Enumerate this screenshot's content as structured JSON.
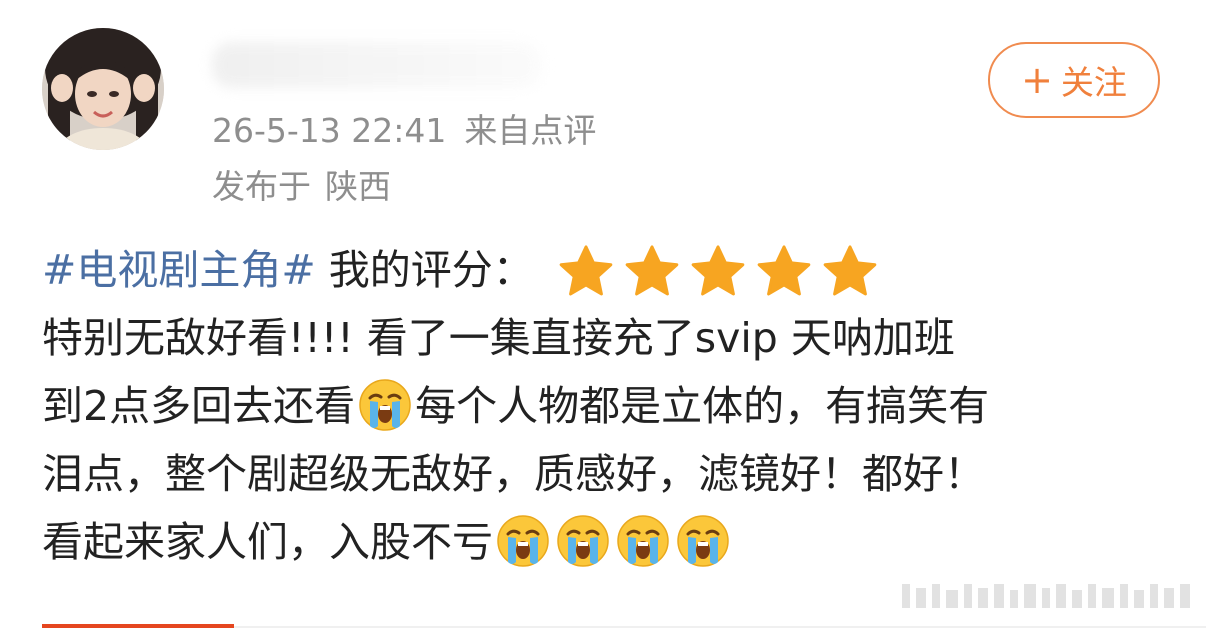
{
  "user": {
    "avatar_icon": "user-avatar-photo",
    "post_time": "26-5-13 22:41",
    "source": "来自点评",
    "location_prefix": "发布于",
    "location": "陕西"
  },
  "follow_button": {
    "icon": "plus-icon",
    "plus_symbol": "+",
    "label": "关注",
    "color": "#f0803c"
  },
  "post": {
    "hashtag": "#电视剧主角#",
    "rating_label": " 我的评分：",
    "rating_stars": 5,
    "rating_max": 5,
    "star_color": "#f7a521",
    "hashtag_color": "#4b6fa3",
    "line2": "特别无敌好看!!!! 看了一集直接充了svip 天呐加班",
    "line3_a": "到2点多回去还看",
    "line3_b": "每个人物都是立体的，有搞笑有",
    "line4": "泪点，整个剧超级无敌好，质感好，滤镜好！都好！",
    "line5": "看起来家人们，入股不亏",
    "emoji_name": "loudly-crying-face-emoji",
    "trailing_emoji_count": 4
  },
  "accent_color": "#e5461f"
}
